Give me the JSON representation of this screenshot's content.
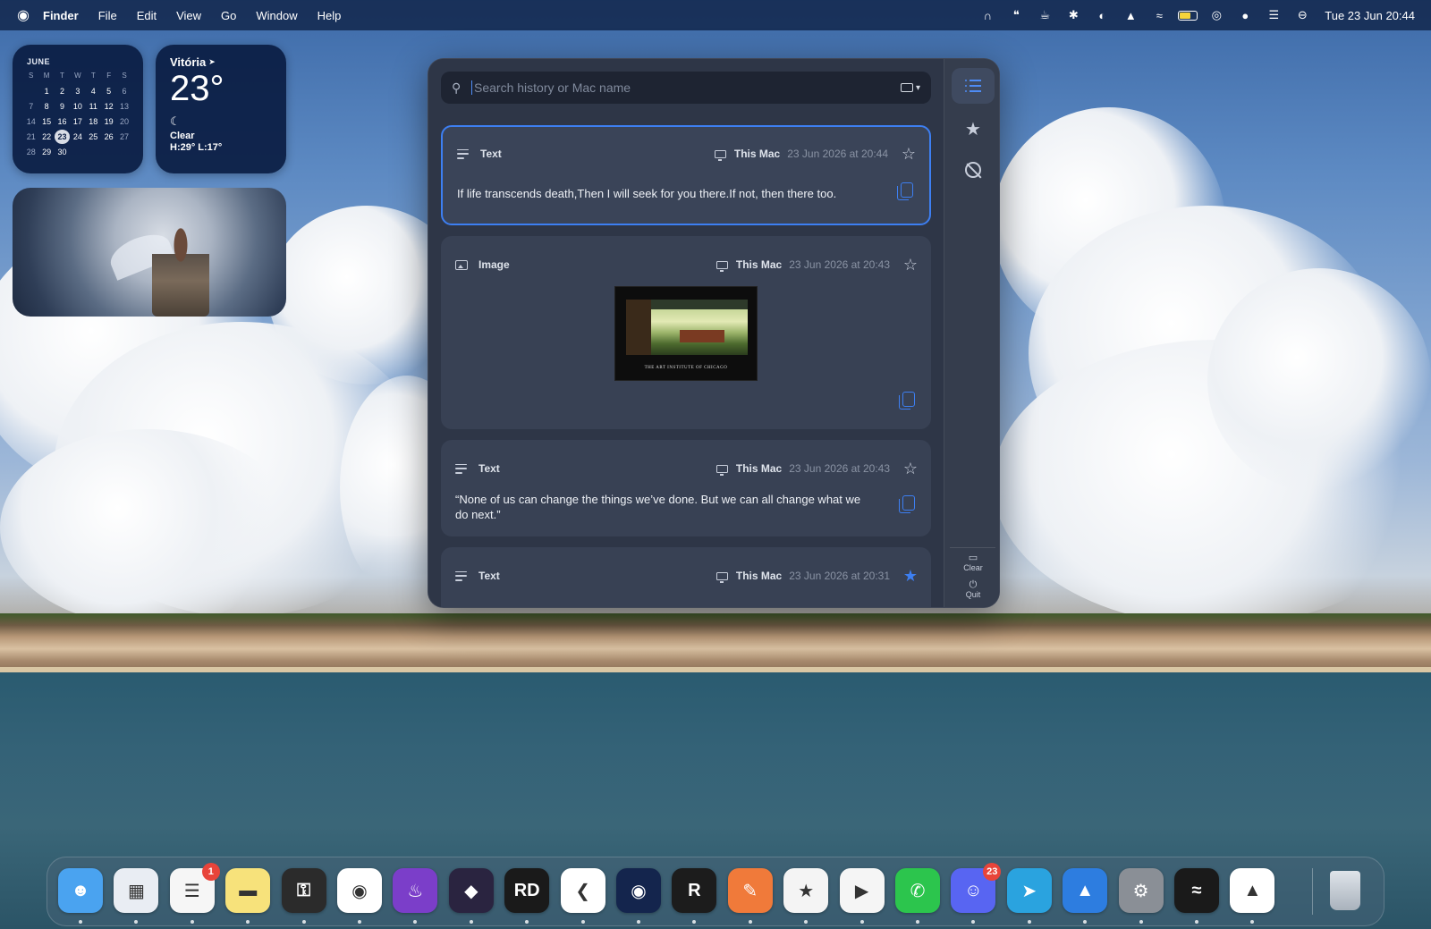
{
  "menubar": {
    "app_name": "Finder",
    "menus": [
      "File",
      "Edit",
      "View",
      "Go",
      "Window",
      "Help"
    ],
    "clock": "Tue 23 Jun  20:44",
    "status_icons": [
      "screen-mirroring-icon",
      "quotes-icon",
      "coffee-icon",
      "bluetooth-icon",
      "focus-moon-icon",
      "location-arrow-icon",
      "wifi-icon",
      "battery-icon",
      "airdrop-icon",
      "bear-icon",
      "control-center-icon",
      "siri-icon"
    ]
  },
  "calendar_widget": {
    "month": "JUNE",
    "weekdays": [
      "S",
      "M",
      "T",
      "W",
      "T",
      "F",
      "S"
    ],
    "weeks": [
      [
        "",
        "1",
        "2",
        "3",
        "4",
        "5",
        "6"
      ],
      [
        "7",
        "8",
        "9",
        "10",
        "11",
        "12",
        "13"
      ],
      [
        "14",
        "15",
        "16",
        "17",
        "18",
        "19",
        "20"
      ],
      [
        "21",
        "22",
        "23",
        "24",
        "25",
        "26",
        "27"
      ],
      [
        "28",
        "29",
        "30",
        "",
        "",
        "",
        ""
      ]
    ],
    "today": "23"
  },
  "weather_widget": {
    "city": "Vitória",
    "temperature": "23°",
    "condition": "Clear",
    "high_low": "H:29° L:17°"
  },
  "clipboard": {
    "search_placeholder": "Search history or Mac name",
    "entries": [
      {
        "type": "Text",
        "device": "This Mac",
        "time": "23 Jun 2026 at 20:44",
        "starred": false,
        "content": "If life transcends death,Then I will seek for you there.If not, then there too."
      },
      {
        "type": "Image",
        "device": "This Mac",
        "time": "23 Jun 2026 at 20:43",
        "starred": false,
        "image_caption": "THE ART INSTITUTE OF CHICAGO"
      },
      {
        "type": "Text",
        "device": "This Mac",
        "time": "23 Jun 2026 at 20:43",
        "starred": false,
        "content": "“None of us can change the things we’ve done. But we can all change what we do next.”"
      },
      {
        "type": "Text",
        "device": "This Mac",
        "time": "23 Jun 2026 at 20:31",
        "starred": true,
        "content": ""
      }
    ],
    "sidebar": {
      "clear_label": "Clear",
      "quit_label": "Quit"
    }
  },
  "dock": {
    "apps": [
      {
        "name": "Finder",
        "color": "#4aa3f0"
      },
      {
        "name": "Launchpad",
        "color": "#e9edf3"
      },
      {
        "name": "Reminders",
        "color": "#f6f6f6",
        "badge": "1"
      },
      {
        "name": "Notes",
        "color": "#f7e27b"
      },
      {
        "name": "Keychain",
        "color": "#2b2b2b"
      },
      {
        "name": "Chrome",
        "color": "#ffffff"
      },
      {
        "name": "Firefox",
        "color": "#7b3ec9"
      },
      {
        "name": "Obsidian",
        "color": "#2a2440"
      },
      {
        "name": "RD",
        "label": "RD",
        "color": "#1a1a1a"
      },
      {
        "name": "VS Code",
        "color": "#ffffff"
      },
      {
        "name": "Ghostty",
        "color": "#14254d"
      },
      {
        "name": "Rive",
        "color": "#1c1c1c"
      },
      {
        "name": "Paw",
        "color": "#f07a3a"
      },
      {
        "name": "TablePlus",
        "color": "#f4f4f4"
      },
      {
        "name": "YouTube Music",
        "color": "#f5f5f5"
      },
      {
        "name": "WhatsApp",
        "color": "#2cc54d"
      },
      {
        "name": "Discord",
        "color": "#5865f2",
        "badge": "23"
      },
      {
        "name": "Telegram",
        "color": "#2aa3df"
      },
      {
        "name": "Testflight",
        "color": "#2d7de0"
      },
      {
        "name": "System Settings",
        "color": "#8a8f96"
      },
      {
        "name": "Spotify",
        "color": "#1a1a1a"
      },
      {
        "name": "Arc",
        "color": "#ffffff"
      }
    ],
    "trash": {
      "name": "Trash",
      "color": "#dfe4ea"
    }
  }
}
